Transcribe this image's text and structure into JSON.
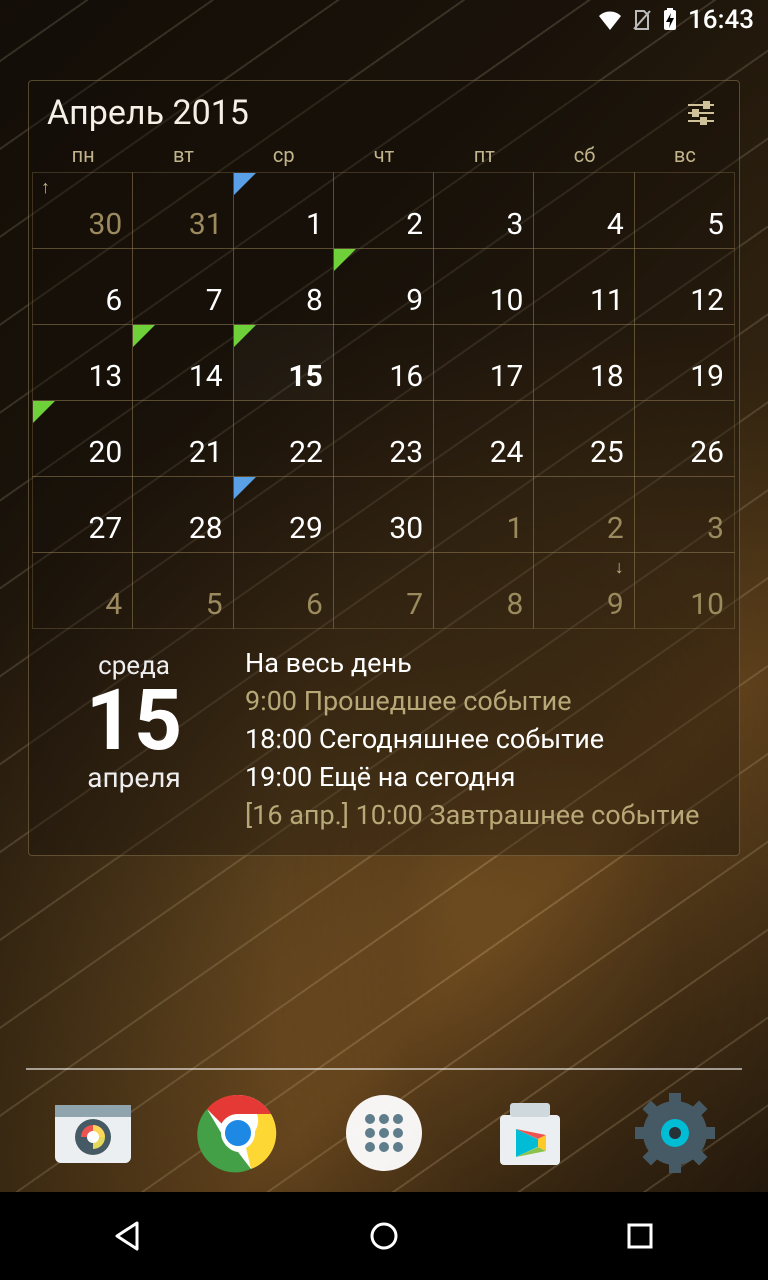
{
  "status": {
    "time": "16:43"
  },
  "widget": {
    "title": "Апрель 2015",
    "weekdays": [
      "пн",
      "вт",
      "ср",
      "чт",
      "пт",
      "сб",
      "вс"
    ],
    "grid": [
      [
        {
          "d": "30",
          "dim": true,
          "nav": "up"
        },
        {
          "d": "31",
          "dim": true
        },
        {
          "d": "1",
          "mark": "blue"
        },
        {
          "d": "2"
        },
        {
          "d": "3"
        },
        {
          "d": "4"
        },
        {
          "d": "5"
        }
      ],
      [
        {
          "d": "6"
        },
        {
          "d": "7"
        },
        {
          "d": "8"
        },
        {
          "d": "9",
          "mark": "green"
        },
        {
          "d": "10"
        },
        {
          "d": "11"
        },
        {
          "d": "12"
        }
      ],
      [
        {
          "d": "13"
        },
        {
          "d": "14",
          "mark": "green"
        },
        {
          "d": "15",
          "today": true,
          "mark": "green"
        },
        {
          "d": "16"
        },
        {
          "d": "17"
        },
        {
          "d": "18"
        },
        {
          "d": "19"
        }
      ],
      [
        {
          "d": "20",
          "mark": "green"
        },
        {
          "d": "21"
        },
        {
          "d": "22"
        },
        {
          "d": "23"
        },
        {
          "d": "24"
        },
        {
          "d": "25"
        },
        {
          "d": "26"
        }
      ],
      [
        {
          "d": "27"
        },
        {
          "d": "28"
        },
        {
          "d": "29",
          "mark": "blue"
        },
        {
          "d": "30"
        },
        {
          "d": "1",
          "dim": true
        },
        {
          "d": "2",
          "dim": true
        },
        {
          "d": "3",
          "dim": true
        }
      ],
      [
        {
          "d": "4",
          "dim": true
        },
        {
          "d": "5",
          "dim": true
        },
        {
          "d": "6",
          "dim": true
        },
        {
          "d": "7",
          "dim": true
        },
        {
          "d": "8",
          "dim": true
        },
        {
          "d": "9",
          "dim": true,
          "nav": "down"
        },
        {
          "d": "10",
          "dim": true
        }
      ]
    ],
    "detail": {
      "dow": "среда",
      "day": "15",
      "month": "апреля",
      "events": [
        {
          "text": "На весь день",
          "cls": "white"
        },
        {
          "text": "9:00 Прошедшее событие",
          "cls": "mut"
        },
        {
          "text": "18:00 Сегодняшнее событие",
          "cls": "white"
        },
        {
          "text": "19:00 Ещё на сегодня",
          "cls": "white"
        },
        {
          "text": "[16 апр.] 10:00 Завтрашнее событие",
          "cls": "mut"
        }
      ]
    }
  },
  "dock": {
    "apps": [
      {
        "name": "camera-app"
      },
      {
        "name": "chrome-app"
      },
      {
        "name": "app-drawer"
      },
      {
        "name": "play-store-app"
      },
      {
        "name": "settings-app"
      }
    ]
  }
}
